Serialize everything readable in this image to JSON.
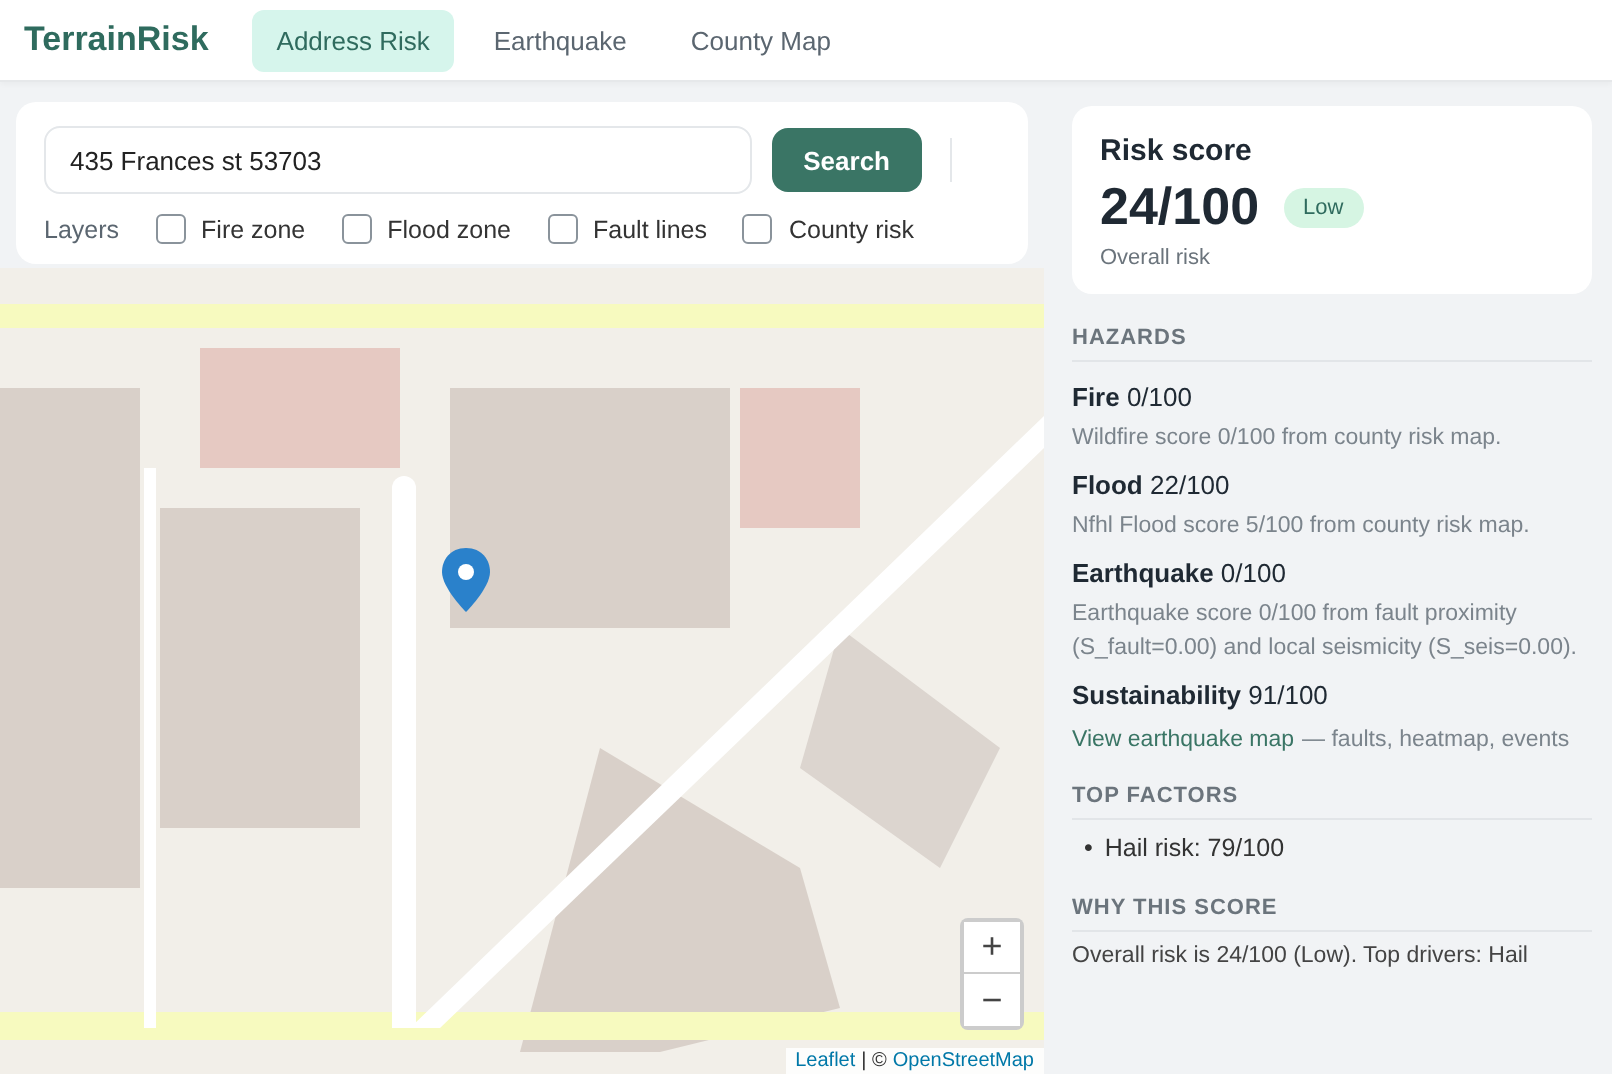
{
  "app": {
    "name": "TerrainRisk"
  },
  "tabs": [
    {
      "label": "Address Risk",
      "selected": true
    },
    {
      "label": "Earthquake",
      "selected": false
    },
    {
      "label": "County Map",
      "selected": false
    }
  ],
  "search": {
    "value": "435 Frances st 53703",
    "button": "Search"
  },
  "layers": {
    "label": "Layers",
    "items": [
      {
        "label": "Fire zone",
        "checked": false
      },
      {
        "label": "Flood zone",
        "checked": false
      },
      {
        "label": "Fault lines",
        "checked": false
      },
      {
        "label": "County risk",
        "checked": false
      }
    ]
  },
  "map": {
    "zoom_in": "+",
    "zoom_out": "−",
    "attribution": {
      "leaflet": "Leaflet",
      "separator": "| ©",
      "osm": "OpenStreetMap"
    }
  },
  "risk": {
    "title": "Risk score",
    "score": "24/100",
    "badge": "Low",
    "caption": "Overall risk"
  },
  "hazards": {
    "heading": "HAZARDS",
    "items": [
      {
        "title": "**Fire** 0/100",
        "description": "Wildfire score 0/100 from county risk map."
      },
      {
        "title": "**Flood** 22/100",
        "description": "Nfhl Flood score 5/100 from county risk map."
      },
      {
        "title": "**Earthquake** 0/100",
        "description": "Earthquake score 0/100 from fault proximity (S_fault=0.00) and local seismicity (S_seis=0.00)."
      },
      {
        "title": "**Sustainability** 91/100"
      }
    ],
    "link": {
      "label": "View earthquake map",
      "note": "— faults, heatmap, events"
    }
  },
  "top_factors": {
    "heading": "TOP FACTORS",
    "items": [
      {
        "bullet": "•",
        "text": "Hail risk: 79/100"
      }
    ]
  },
  "why": {
    "heading": "WHY THIS SCORE",
    "text": "Overall risk is 24/100 (Low). Top drivers: Hail"
  }
}
